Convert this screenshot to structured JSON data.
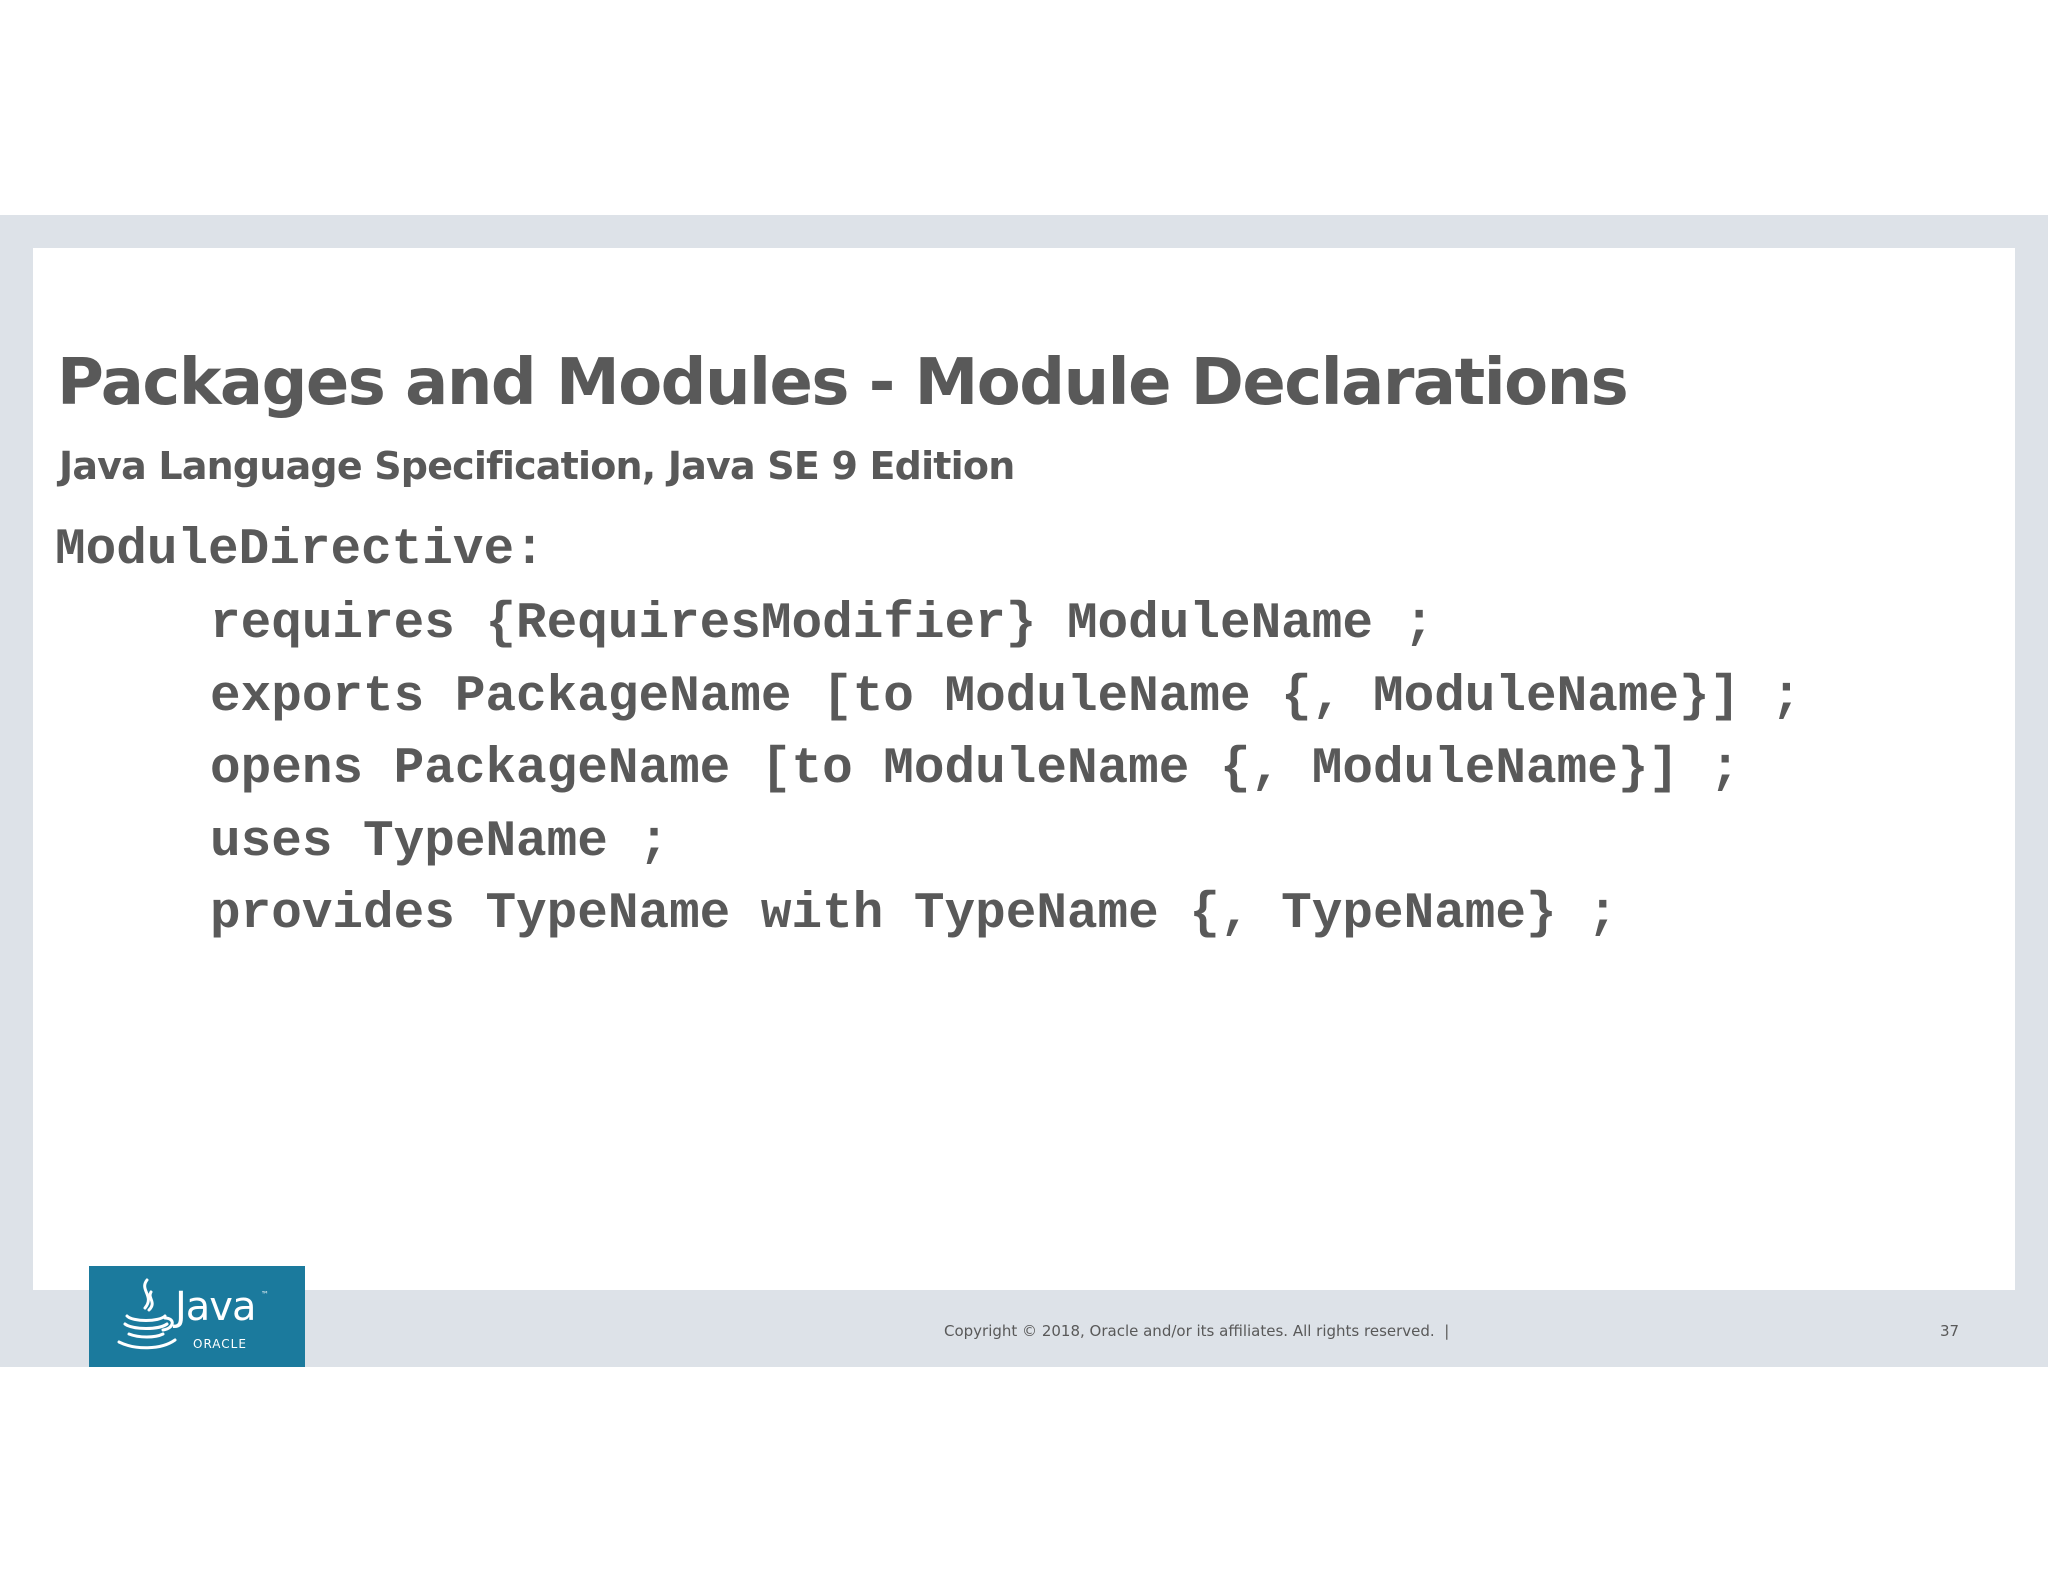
{
  "slide": {
    "title": "Packages and Modules - Module Declarations",
    "subtitle": "Java Language Specification,  Java SE 9 Edition",
    "code": {
      "heading": "ModuleDirective:",
      "lines": [
        "requires {RequiresModifier} ModuleName ;",
        "exports PackageName [to ModuleName {, ModuleName}] ;",
        "opens PackageName [to ModuleName {, ModuleName}] ;",
        "uses TypeName ;",
        "provides TypeName with TypeName {, TypeName} ;"
      ]
    },
    "footer": {
      "copyright": "Copyright © 2018, Oracle and/or its affiliates. All rights reserved.  |",
      "page_number": "37"
    },
    "logo": {
      "icon": "java-cup-icon",
      "java_text": "Java",
      "tm": "™",
      "oracle_text": "ORACLE",
      "background_color": "#1b7a9d"
    },
    "colors": {
      "text": "#595959",
      "frame": "#dde2e8"
    }
  }
}
